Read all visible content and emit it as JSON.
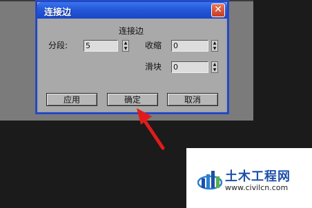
{
  "dialog": {
    "title": "连接边",
    "close_symbol": "✕",
    "section_title": "连接边",
    "fields": {
      "segments": {
        "label": "分段:",
        "value": "5"
      },
      "pinch": {
        "label": "收缩",
        "value": "0"
      },
      "slide": {
        "label": "滑块",
        "value": "0"
      }
    },
    "buttons": {
      "apply": "应用",
      "ok": "确定",
      "cancel": "取消"
    }
  },
  "watermark": {
    "brand": "土木工程网",
    "url": "www.civilcn.com"
  },
  "colors": {
    "titlebar": "#2458d8",
    "annotation_arrow": "#e11b1b",
    "dialog_body": "#a9a9a9"
  }
}
